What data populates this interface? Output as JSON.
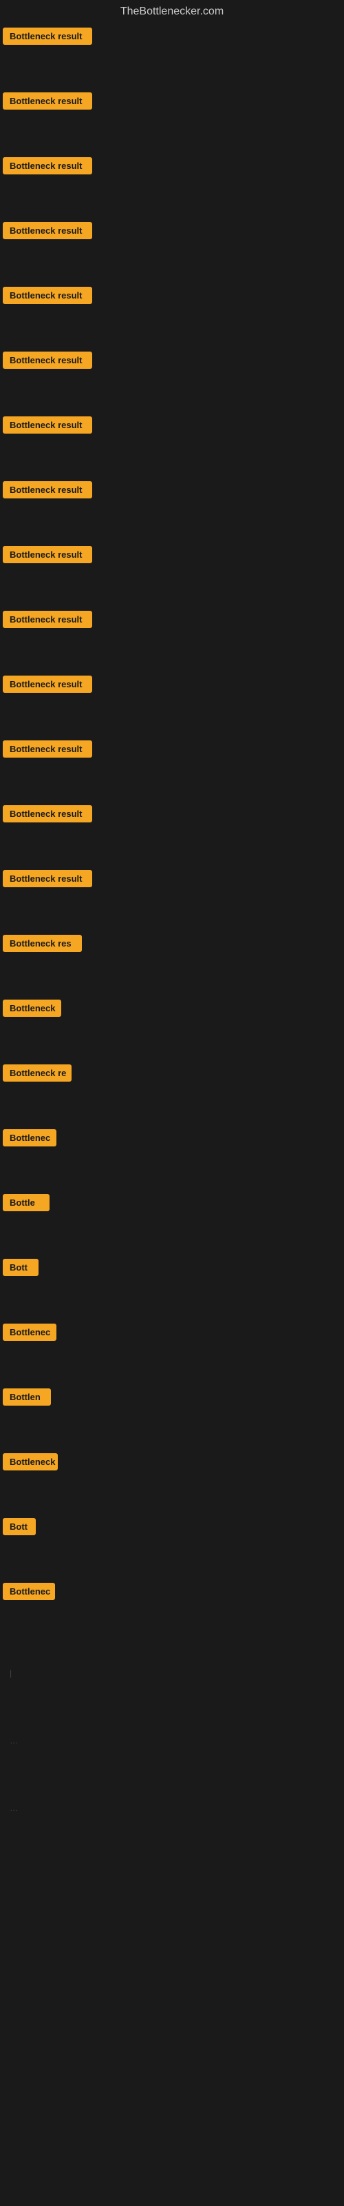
{
  "site": {
    "title": "TheBottlenecker.com"
  },
  "items": [
    {
      "id": 0,
      "label": "Bottleneck result",
      "yOffset": 57
    },
    {
      "id": 1,
      "label": "Bottleneck result",
      "yOffset": 143
    },
    {
      "id": 2,
      "label": "Bottleneck result",
      "yOffset": 234
    },
    {
      "id": 3,
      "label": "Bottleneck result",
      "yOffset": 321
    },
    {
      "id": 4,
      "label": "Bottleneck result",
      "yOffset": 410
    },
    {
      "id": 5,
      "label": "Bottleneck result",
      "yOffset": 500
    },
    {
      "id": 6,
      "label": "Bottleneck result",
      "yOffset": 590
    },
    {
      "id": 7,
      "label": "Bottleneck result",
      "yOffset": 676
    },
    {
      "id": 8,
      "label": "Bottleneck result",
      "yOffset": 762
    },
    {
      "id": 9,
      "label": "Bottleneck result",
      "yOffset": 852
    },
    {
      "id": 10,
      "label": "Bottleneck result",
      "yOffset": 940
    },
    {
      "id": 11,
      "label": "Bottleneck result",
      "yOffset": 1030
    },
    {
      "id": 12,
      "label": "Bottleneck result",
      "yOffset": 1118
    },
    {
      "id": 13,
      "label": "Bottleneck result",
      "yOffset": 1208
    },
    {
      "id": 14,
      "label": "Bottleneck res",
      "yOffset": 1298
    },
    {
      "id": 15,
      "label": "Bottleneck",
      "yOffset": 1388
    },
    {
      "id": 16,
      "label": "Bottleneck re",
      "yOffset": 1478
    },
    {
      "id": 17,
      "label": "Bottlenec",
      "yOffset": 1568
    },
    {
      "id": 18,
      "label": "Bottle",
      "yOffset": 1658
    },
    {
      "id": 19,
      "label": "Bott",
      "yOffset": 1748
    },
    {
      "id": 20,
      "label": "Bottlenec",
      "yOffset": 1838
    },
    {
      "id": 21,
      "label": "Bottlen",
      "yOffset": 1928
    },
    {
      "id": 22,
      "label": "Bottleneck",
      "yOffset": 2018
    },
    {
      "id": 23,
      "label": "Bott",
      "yOffset": 2108
    },
    {
      "id": 24,
      "label": "Bottlenec",
      "yOffset": 2198
    }
  ],
  "colors": {
    "badge_bg": "#f5a623",
    "badge_text": "#1a1a1a",
    "bg": "#1a1a1a",
    "title": "#cccccc"
  }
}
